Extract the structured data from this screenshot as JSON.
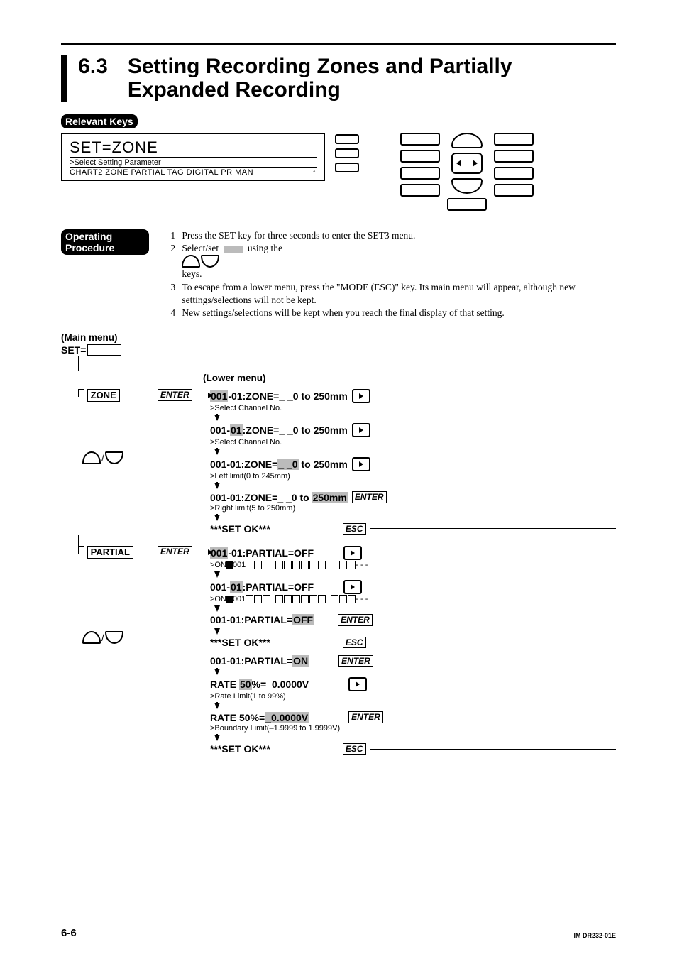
{
  "heading": {
    "num": "6.3",
    "title": "Setting Recording Zones and Partially Expanded Recording"
  },
  "labels": {
    "relevant_keys": "Relevant Keys",
    "operating_procedure": "Operating Procedure",
    "main_menu": "(Main menu)",
    "set_eq": "SET=",
    "lower_menu": "(Lower menu)",
    "enter": "ENTER",
    "esc": "ESC"
  },
  "lcd": {
    "top": "SET=ZONE",
    "mid": ">Select Setting Parameter",
    "bot_left": "CHART2  ZONE  PARTIAL  TAG  DIGITAL  PR  MAN",
    "bot_arrow": "↑"
  },
  "procedure": [
    "Press the SET key for three seconds to enter the SET3 menu.",
    "Select/set            using the             keys.",
    "To escape from a lower menu, press the \"MODE (ESC)\" key. Its main menu will appear, although new settings/selections will not be kept.",
    "New settings/selections will be kept when you reach the final display of that setting."
  ],
  "zone": {
    "label": "ZONE",
    "steps": [
      {
        "line": "001-01:ZONE=_ _0 to 250mm",
        "sel": "001",
        "sub": ">Select Channel No.",
        "key": "right"
      },
      {
        "line": "001-01:ZONE=_ _0 to 250mm",
        "sel": "01",
        "sub": ">Select Channel No.",
        "key": "right"
      },
      {
        "line": "001-01:ZONE=_ _0 to 250mm",
        "sel": "_ _0",
        "sub": ">Left limit(0 to 245mm)",
        "key": "right"
      },
      {
        "line": "001-01:ZONE=_ _0 to 250mm",
        "sel": "250mm",
        "sub": ">Right limit(5 to 250mm)",
        "key": "enter"
      }
    ],
    "ok": "***SET OK***"
  },
  "partial": {
    "label": "PARTIAL",
    "steps_a": [
      {
        "line": "001-01:PARTIAL=OFF",
        "sel": "001",
        "sub_prefix": ">ON",
        "sub_text": "001",
        "key": "right",
        "boxes": true
      },
      {
        "line": "001-01:PARTIAL=OFF",
        "sel": "01",
        "sub_prefix": ">ON",
        "sub_text": "001",
        "key": "right",
        "boxes": true
      },
      {
        "line": "001-01:PARTIAL=OFF",
        "sel": "OFF",
        "sub": "",
        "key": "enter"
      }
    ],
    "ok1": "***SET OK***",
    "on_step": {
      "line": "001-01:PARTIAL=ON",
      "sel": "ON",
      "key": "enter"
    },
    "rate1": {
      "line": "RATE 50%=_0.0000V",
      "sel": "50",
      "sub": ">Rate Limit(1 to 99%)",
      "key": "right"
    },
    "rate2": {
      "line": "RATE 50%=_0.0000V",
      "sel": "_0.0000V",
      "sub": ">Boundary Limit(–1.9999 to 1.9999V)",
      "key": "enter"
    },
    "ok2": "***SET OK***"
  },
  "footer": {
    "page": "6-6",
    "doc": "IM DR232-01E"
  }
}
